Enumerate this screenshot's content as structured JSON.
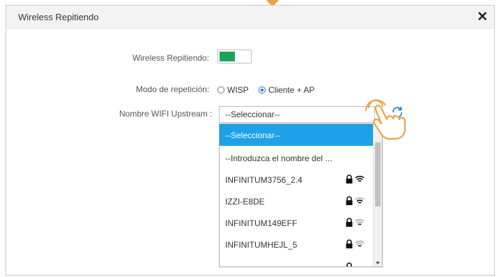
{
  "dialog": {
    "title": "Wireless Repitiendo",
    "close_icon": "close-icon"
  },
  "form": {
    "repeater_label": "Wireless Repitiendo:",
    "repeater_enabled": true,
    "mode_label": "Modo de repetición:",
    "mode_options": [
      "WISP",
      "Cliente + AP"
    ],
    "mode_selected": "Cliente + AP",
    "upstream_label": "Nombre WIFI Upstream :",
    "upstream_value": "--Seleccionar--"
  },
  "dropdown": {
    "items": [
      {
        "label": "--Seleccionar--",
        "selected": true,
        "lock": false,
        "wifi": false
      },
      {
        "label": "--Introduzca el nombre del ...",
        "selected": false,
        "lock": false,
        "wifi": false
      },
      {
        "label": "INFINITUM3756_2.4",
        "selected": false,
        "lock": true,
        "wifi": true,
        "signal": "strong"
      },
      {
        "label": "IZZI-E8DE",
        "selected": false,
        "lock": true,
        "wifi": true,
        "signal": "medium"
      },
      {
        "label": "INFINITUM149EFF",
        "selected": false,
        "lock": true,
        "wifi": true,
        "signal": "weak"
      },
      {
        "label": "INFINITUMHEJL_5",
        "selected": false,
        "lock": true,
        "wifi": true,
        "signal": "weak"
      }
    ]
  },
  "colors": {
    "toggle_on": "#1aa35a",
    "selected_item": "#1da1e8",
    "radio_accent": "#1e6fd9",
    "hand_highlight": "#f0a040"
  }
}
